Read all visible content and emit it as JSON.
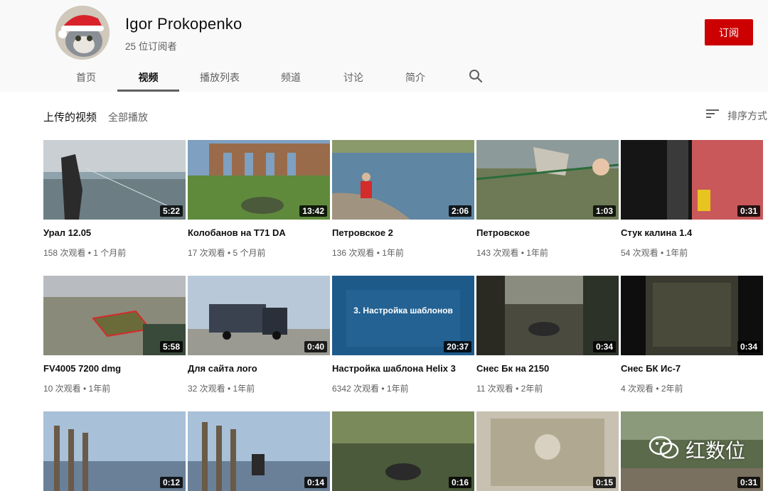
{
  "channel": {
    "name": "Igor Prokopenko",
    "subscribers": "25 位订阅者",
    "subscribe_label": "订阅"
  },
  "tabs": [
    {
      "label": "首页"
    },
    {
      "label": "视频"
    },
    {
      "label": "播放列表"
    },
    {
      "label": "频道"
    },
    {
      "label": "讨论"
    },
    {
      "label": "简介"
    }
  ],
  "section": {
    "title": "上传的视频",
    "play_all": "全部播放",
    "sort_label": "排序方式"
  },
  "videos": [
    {
      "title": "Урал 12.05",
      "meta": "158 次观看 • 1 个月前",
      "duration": "5:22"
    },
    {
      "title": "Колобанов на Т71 DA",
      "meta": "17 次观看 • 5 个月前",
      "duration": "13:42"
    },
    {
      "title": "Петровское 2",
      "meta": "136 次观看 • 1年前",
      "duration": "2:06"
    },
    {
      "title": "Петровское",
      "meta": "143 次观看 • 1年前",
      "duration": "1:03"
    },
    {
      "title": "Стук калина 1.4",
      "meta": "54 次观看 • 1年前",
      "duration": "0:31"
    },
    {
      "title": "FV4005 7200 dmg",
      "meta": "10 次观看 • 1年前",
      "duration": "5:58"
    },
    {
      "title": "Для сайта лого",
      "meta": "32 次观看 • 1年前",
      "duration": "0:40"
    },
    {
      "title": "Настройка шаблона Helix 3",
      "meta": "6342 次观看 • 1年前",
      "duration": "20:37",
      "thumb_text": "3. Настройка шаблонов"
    },
    {
      "title": "Снес Бк на 2150",
      "meta": "11 次观看 • 2年前",
      "duration": "0:34"
    },
    {
      "title": "Снес БК Ис-7",
      "meta": "4 次观看 • 2年前",
      "duration": "0:34"
    },
    {
      "title": "",
      "meta": "",
      "duration": "0:12"
    },
    {
      "title": "",
      "meta": "",
      "duration": "0:14"
    },
    {
      "title": "",
      "meta": "",
      "duration": "0:16"
    },
    {
      "title": "",
      "meta": "",
      "duration": "0:15"
    },
    {
      "title": "",
      "meta": "",
      "duration": "0:31"
    }
  ],
  "watermark": {
    "text": "红数位"
  },
  "colors": {
    "subscribe": "#cc0000",
    "header_bg": "#f9f9f9",
    "meta_text": "#606060"
  },
  "icons": [
    "search-icon",
    "sort-icon",
    "wechat-icon"
  ]
}
